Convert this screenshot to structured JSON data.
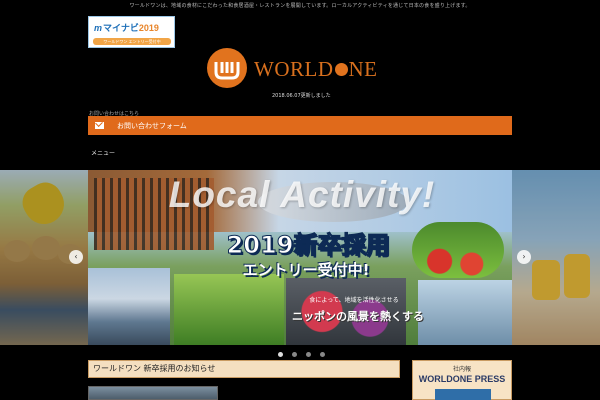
{
  "header": {
    "tagline": "ワールドワンは、地域の食材にこだわった和食居酒屋・レストランを展開しています。ローカルアクティビティを通じて日本の食を盛り上げます。",
    "mynavi_banner": {
      "title_mark": "m",
      "title": "マイナビ",
      "year": "2019",
      "subtitle": "ワールドワン エントリー受付中"
    },
    "logo_text_before": "WORLD",
    "logo_text_after": "NE",
    "date_text": "2018.06.07更新しました",
    "small_caption": "お問い合わせはこちら",
    "contact_label": "お問い合わせフォーム",
    "menu_label": "メニュー"
  },
  "slider": {
    "activity_text": "Local Activity!",
    "headline": "2019新卒採用",
    "subhead": "エントリー受付中!",
    "tag_small": "食によって、地域を活性化させる",
    "tag_big": "ニッポンの風景を熱くする",
    "prev_icon": "‹",
    "next_icon": "›",
    "slide_count": 4,
    "active_index": 0
  },
  "news": {
    "heading": "ワールドワン 新卒採用のお知らせ"
  },
  "press": {
    "small": "社内報",
    "title": "WORLDONE PRESS"
  },
  "colors": {
    "accent": "#e06a1b",
    "banner_border": "#c99b62",
    "banner_bg": "#f4dfc0"
  }
}
